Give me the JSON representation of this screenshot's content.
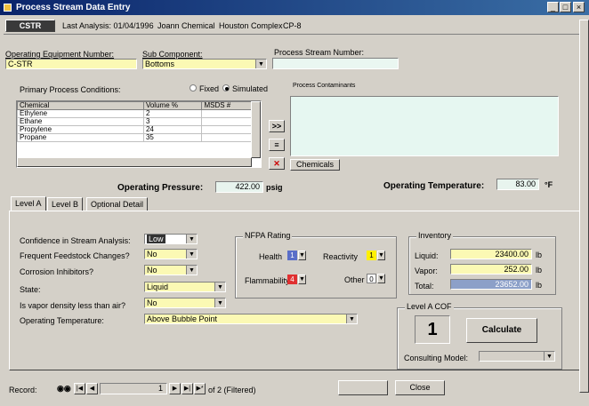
{
  "window": {
    "title": "Process Stream Data Entry",
    "minimize": "_",
    "maximize": "□",
    "close": "×"
  },
  "header": {
    "record_tab": "CSTR",
    "last_analysis": "Last Analysis: 01/04/1996",
    "analyst": "Joann Chemical",
    "compiler": "Houston Complex",
    "unit": "CP-8"
  },
  "fields": {
    "operating_equipment_label": "Operating Equipment Number:",
    "operating_equipment_value": "C-STR",
    "sub_component_label": "Sub Component:",
    "sub_component_value": "Bottoms",
    "process_stream_label": "Process Stream Number:",
    "process_stream_value": "",
    "primary_conditions_label": "Primary Process Conditions:",
    "radio_fixed": "Fixed",
    "radio_simulated": "Simulated",
    "process_contaminants_label": "Process Contaminants"
  },
  "chemicals": {
    "headers": [
      "Chemical",
      "Volume %",
      "MSDS #"
    ],
    "rows": [
      [
        "Ethylene",
        "2",
        ""
      ],
      [
        "Ethane",
        "3",
        ""
      ],
      [
        "Propylene",
        "24",
        ""
      ],
      [
        "Propane",
        "35",
        ""
      ]
    ],
    "btn_add": ">>",
    "btn_list": "≡",
    "btn_del": "✕",
    "btn_chemicals": "Chemicals"
  },
  "conditions": {
    "pressure_label": "Operating Pressure:",
    "pressure_value": "422.00",
    "pressure_unit": "psig",
    "temp_label": "Operating Temperature:",
    "temp_value": "83.00",
    "temp_unit": "°F"
  },
  "tabs": [
    "Level A",
    "Level B",
    "Optional Detail"
  ],
  "level_a": {
    "confidence_label": "Confidence in Stream Analysis:",
    "confidence_value": "Low",
    "feedstock_label": "Frequent Feedstock Changes?",
    "feedstock_value": "No",
    "corrosion_label": "Corrosion Inhibitors?",
    "corrosion_value": "No",
    "state_label": "State:",
    "state_value": "Liquid",
    "vapor_label": "Is vapor density less than air?",
    "vapor_value": "No",
    "optemp_label": "Operating Temperature:",
    "optemp_value": "Above Bubble Point"
  },
  "nfpa": {
    "title": "NFPA Rating",
    "health_label": "Health",
    "health_value": "1",
    "reactivity_label": "Reactivity",
    "reactivity_value": "1",
    "flammability_label": "Flammability",
    "flammability_value": "4",
    "other_label": "Other",
    "other_value": "0"
  },
  "inventory": {
    "title": "Inventory",
    "liquid_label": "Liquid:",
    "liquid_value": "23400.00",
    "vapor_label": "Vapor:",
    "vapor_value": "252.00",
    "total_label": "Total:",
    "total_value": "23652.00",
    "unit": "lb"
  },
  "level_a_cof": {
    "title": "Level A COF",
    "value": "1",
    "calculate_label": "Calculate",
    "model_label": "Consulting Model:",
    "model_value": ""
  },
  "bottom": {
    "record_label": "Record:",
    "record_current": "1",
    "record_total": "of 2 (Filtered)",
    "blank_button": "",
    "close_button": "Close"
  },
  "colors": {
    "title_bar": "#0a246a",
    "highlight": "#fbf9b4",
    "health": "#5a6ec8",
    "flammability": "#e03030",
    "reactivity": "#fff000"
  }
}
